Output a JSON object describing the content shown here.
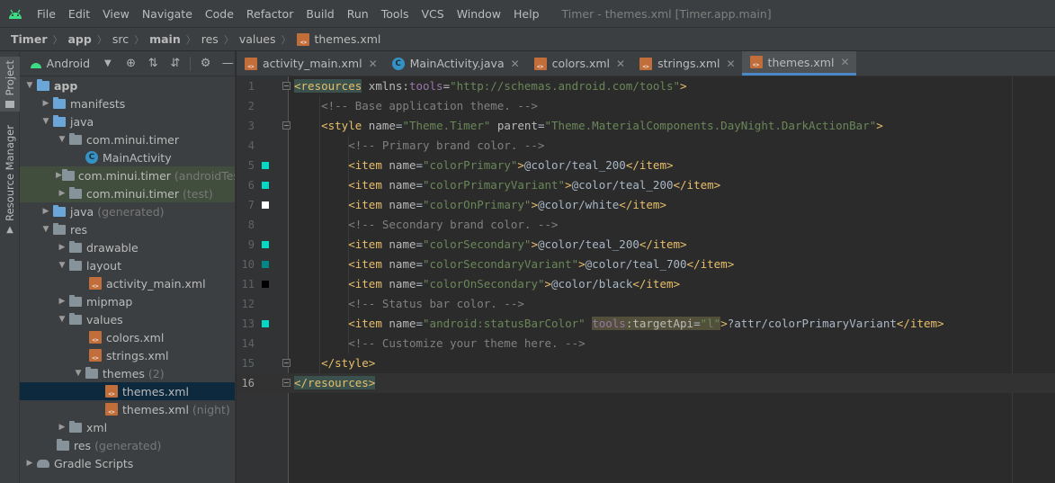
{
  "menubar": {
    "items": [
      "File",
      "Edit",
      "View",
      "Navigate",
      "Code",
      "Refactor",
      "Build",
      "Run",
      "Tools",
      "VCS",
      "Window",
      "Help"
    ],
    "window_title": "Timer - themes.xml [Timer.app.main]"
  },
  "breadcrumb": [
    "Timer",
    "app",
    "src",
    "main",
    "res",
    "values",
    "themes.xml"
  ],
  "left_stripe": {
    "project": "Project",
    "resource_manager": "Resource Manager"
  },
  "project_panel": {
    "view_selector": "Android",
    "tree": [
      {
        "label": "app",
        "extra": ""
      },
      {
        "label": "manifests",
        "extra": ""
      },
      {
        "label": "java",
        "extra": ""
      },
      {
        "label": "com.minui.timer",
        "extra": ""
      },
      {
        "label": "MainActivity",
        "extra": ""
      },
      {
        "label": "com.minui.timer",
        "extra": "(androidTest)"
      },
      {
        "label": "com.minui.timer",
        "extra": "(test)"
      },
      {
        "label": "java",
        "extra": "(generated)"
      },
      {
        "label": "res",
        "extra": ""
      },
      {
        "label": "drawable",
        "extra": ""
      },
      {
        "label": "layout",
        "extra": ""
      },
      {
        "label": "activity_main.xml",
        "extra": ""
      },
      {
        "label": "mipmap",
        "extra": ""
      },
      {
        "label": "values",
        "extra": ""
      },
      {
        "label": "colors.xml",
        "extra": ""
      },
      {
        "label": "strings.xml",
        "extra": ""
      },
      {
        "label": "themes",
        "extra": "(2)"
      },
      {
        "label": "themes.xml",
        "extra": ""
      },
      {
        "label": "themes.xml",
        "extra": "(night)"
      },
      {
        "label": "xml",
        "extra": ""
      },
      {
        "label": "res",
        "extra": "(generated)"
      },
      {
        "label": "Gradle Scripts",
        "extra": ""
      }
    ]
  },
  "editor_tabs": [
    {
      "label": "activity_main.xml",
      "active": false
    },
    {
      "label": "MainActivity.java",
      "active": false
    },
    {
      "label": "colors.xml",
      "active": false
    },
    {
      "label": "strings.xml",
      "active": false
    },
    {
      "label": "themes.xml",
      "active": true
    }
  ],
  "editor": {
    "line_numbers": [
      "1",
      "2",
      "3",
      "4",
      "5",
      "6",
      "7",
      "8",
      "9",
      "10",
      "11",
      "12",
      "13",
      "14",
      "15",
      "16"
    ],
    "swatch_colors": {
      "teal_200": "#03dac5",
      "teal_700": "#018786",
      "white": "#ffffff",
      "black": "#000000"
    },
    "lines": {
      "l1": {
        "open": "<resources",
        "attr": "xmlns:",
        "ns": "tools",
        "eq": "=",
        "val": "\"http://schemas.android.com/tools\"",
        "close": ">"
      },
      "l2": "<!-- Base application theme. -->",
      "l3": {
        "open": "<style",
        "a1": "name",
        "v1": "\"Theme.Timer\"",
        "a2": "parent",
        "v2": "\"Theme.MaterialComponents.DayNight.DarkActionBar\"",
        "close": ">"
      },
      "l4": "<!-- Primary brand color. -->",
      "l5": {
        "open": "<item",
        "a": "name",
        "v": "\"colorPrimary\"",
        "text": "@color/teal_200",
        "end": "</item>"
      },
      "l6": {
        "open": "<item",
        "a": "name",
        "v": "\"colorPrimaryVariant\"",
        "text": "@color/teal_200",
        "end": "</item>"
      },
      "l7": {
        "open": "<item",
        "a": "name",
        "v": "\"colorOnPrimary\"",
        "text": "@color/white",
        "end": "</item>"
      },
      "l8": "<!-- Secondary brand color. -->",
      "l9": {
        "open": "<item",
        "a": "name",
        "v": "\"colorSecondary\"",
        "text": "@color/teal_200",
        "end": "</item>"
      },
      "l10": {
        "open": "<item",
        "a": "name",
        "v": "\"colorSecondaryVariant\"",
        "text": "@color/teal_700",
        "end": "</item>"
      },
      "l11": {
        "open": "<item",
        "a": "name",
        "v": "\"colorOnSecondary\"",
        "text": "@color/black",
        "end": "</item>"
      },
      "l12": "<!-- Status bar color. -->",
      "l13": {
        "open": "<item",
        "a": "name",
        "v": "\"android:statusBarColor\"",
        "ns": "tools",
        "a2": ":targetApi",
        "v2": "\"l\"",
        "text": "?attr/colorPrimaryVariant",
        "end": "</item>"
      },
      "l14": "<!-- Customize your theme here. -->",
      "l15": "</style>",
      "l16": "</resources>"
    }
  }
}
